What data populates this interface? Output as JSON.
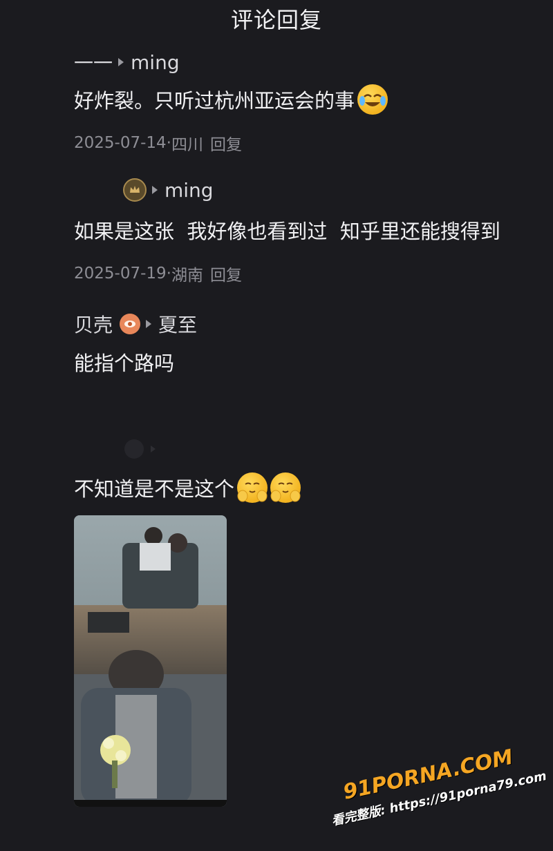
{
  "header": {
    "title": "评论回复"
  },
  "comments": [
    {
      "author": "一一",
      "reply_to": "ming",
      "text": "好炸裂。只听过杭州亚运会的事",
      "date": "2025-07-14",
      "location": "四川",
      "reply_label": "回复",
      "emoji": "crying-laughing-emoji"
    },
    {
      "author_badge": "crown-badge-icon",
      "reply_to": "ming",
      "text": "如果是这张  我好像也看到过  知乎里还能搜得到",
      "date": "2025-07-19",
      "location": "湖南",
      "reply_label": "回复"
    },
    {
      "author": "贝壳",
      "author_badge": "eye-badge-icon",
      "reply_to": "夏至",
      "text": "能指个路吗"
    },
    {
      "text": "不知道是不是这个",
      "emoji": "shy-hands-emoji",
      "image": "photo-attachment"
    }
  ],
  "separator": " · ",
  "watermark": {
    "logo": "91PORNA.COM",
    "url": "看完整版: https://91porna79.com"
  },
  "colors": {
    "background": "#1b1b1f",
    "text": "#f1f1f3",
    "meta": "#8e8e95",
    "watermark": "#f5a623"
  }
}
